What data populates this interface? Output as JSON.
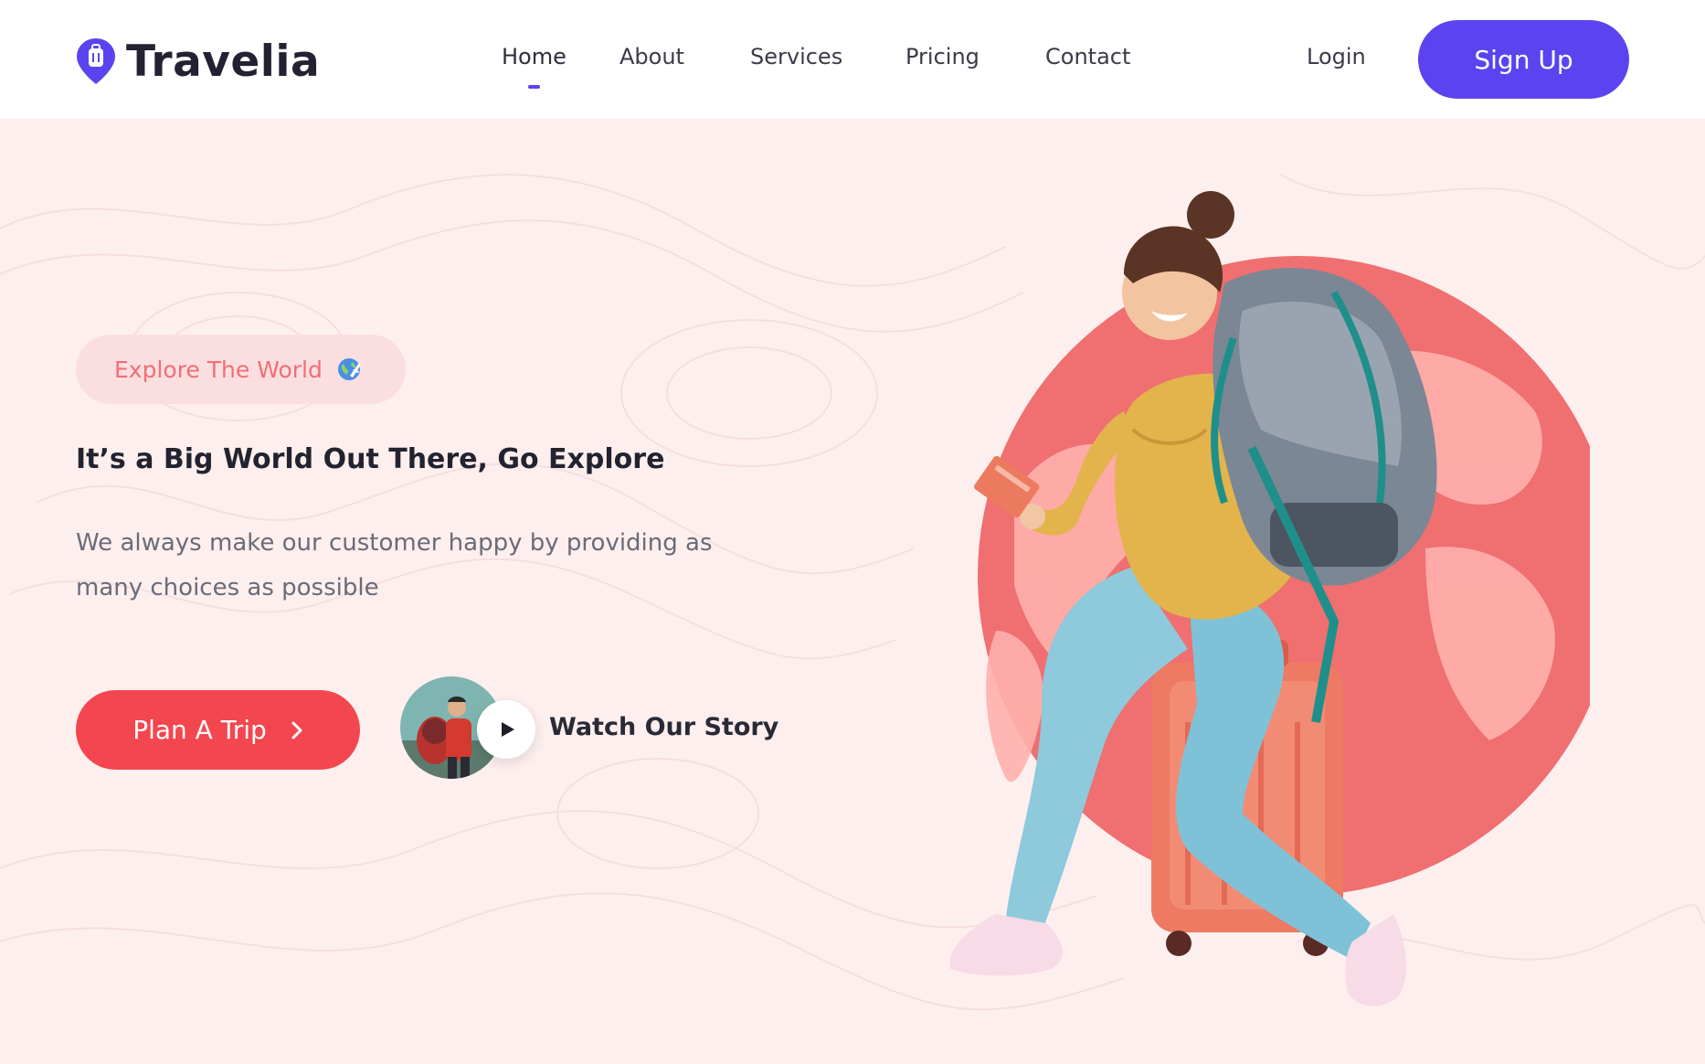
{
  "brand": {
    "name": "Travelia",
    "logo_icon": "map-pin-suitcase-icon",
    "accent_color": "#5b43f0"
  },
  "nav": {
    "items": [
      {
        "label": "Home",
        "active": true
      },
      {
        "label": "About"
      },
      {
        "label": "Services"
      },
      {
        "label": "Pricing"
      },
      {
        "label": "Contact"
      }
    ],
    "login_label": "Login",
    "signup_label": "Sign Up"
  },
  "hero": {
    "badge_text": "Explore The World",
    "badge_icon": "globe-plane-icon",
    "headline": "It’s a Big World Out There, Go Explore",
    "description": "We always make our customer happy by providing as many choices as possible",
    "cta_label": "Plan A Trip",
    "cta_icon": "chevron-right-icon",
    "story_label": "Watch Our Story",
    "story_icon": "play-icon",
    "cta_color": "#f4464e",
    "background_color": "#fdefee"
  }
}
